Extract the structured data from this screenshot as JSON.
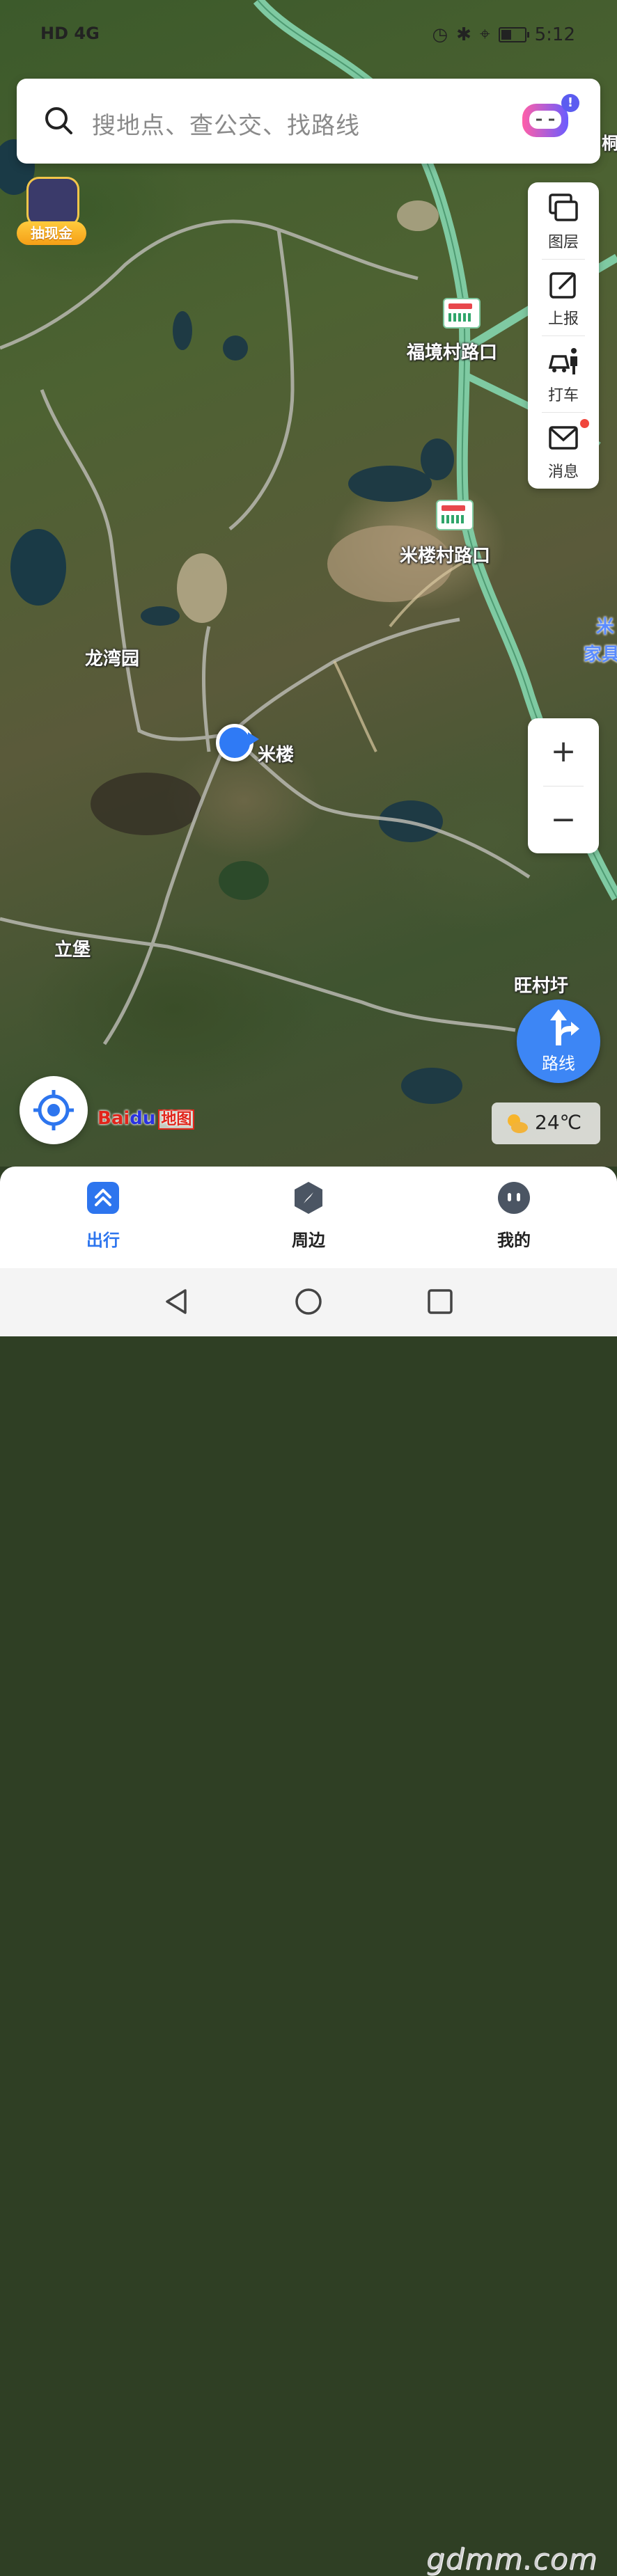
{
  "status_bar": {
    "left": "HD 4G",
    "time": "5:12"
  },
  "search": {
    "placeholder": "搜地点、查公交、找路线",
    "badge": "!"
  },
  "promo": {
    "label": "抽现金"
  },
  "tools": [
    {
      "label": "图层",
      "icon": "layers-icon"
    },
    {
      "label": "上报",
      "icon": "report-edit-icon"
    },
    {
      "label": "打车",
      "icon": "taxi-icon"
    },
    {
      "label": "消息",
      "icon": "mail-icon"
    }
  ],
  "map_labels": {
    "fujing": "福境村路口",
    "milou_junction": "米楼村路口",
    "longwan": "龙湾园",
    "milou": "米楼",
    "libao": "立堡",
    "wangcun": "旺村圩",
    "edge_right_1": "米",
    "edge_right_2": "家具",
    "edge_top": "桐"
  },
  "zoom": {
    "in": "+",
    "out": "−"
  },
  "route": {
    "label": "路线"
  },
  "logo": {
    "bai": "Bai",
    "du": "du",
    "ditu": "地图"
  },
  "weather": {
    "temp": "24℃"
  },
  "bottom_nav": [
    {
      "label": "出行",
      "active": true
    },
    {
      "label": "周边",
      "active": false
    },
    {
      "label": "我的",
      "active": false
    }
  ],
  "watermark": "gdmm.com",
  "colors": {
    "accent": "#2d75ee",
    "route_blue": "#3d86f5",
    "road_green": "#7fcaa2"
  }
}
